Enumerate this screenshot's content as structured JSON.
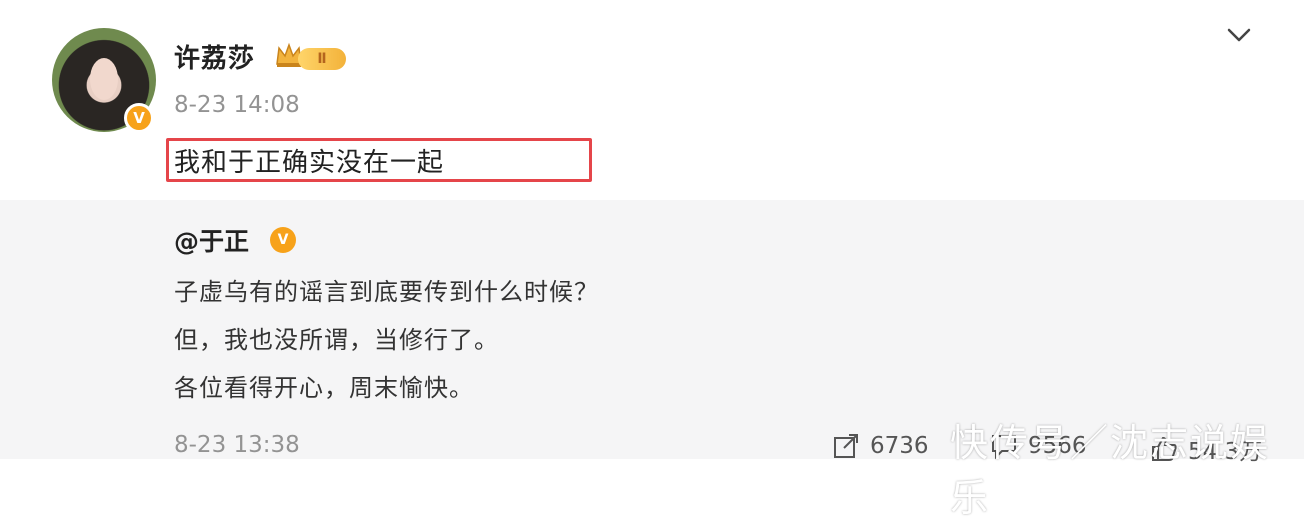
{
  "post": {
    "username": "许荔莎",
    "level_badge": "Ⅱ",
    "timestamp": "8-23 14:08",
    "text": "我和于正确实没在一起",
    "verified_icon": "verified-v-icon",
    "highlight_color": "#e5454a"
  },
  "repost": {
    "author": "@于正",
    "lines": [
      "子虚乌有的谣言到底要传到什么时候？",
      "但，我也没所谓，当修行了。",
      "各位看得开心，周末愉快。"
    ],
    "timestamp": "8-23 13:38",
    "stats": {
      "reposts": "6736",
      "comments": "9566",
      "likes": "54.3万"
    }
  },
  "watermark": "快传号／沈志说娱乐",
  "colors": {
    "verified": "#f7a21a",
    "muted_text": "#939393",
    "repost_bg": "#f5f5f6"
  }
}
